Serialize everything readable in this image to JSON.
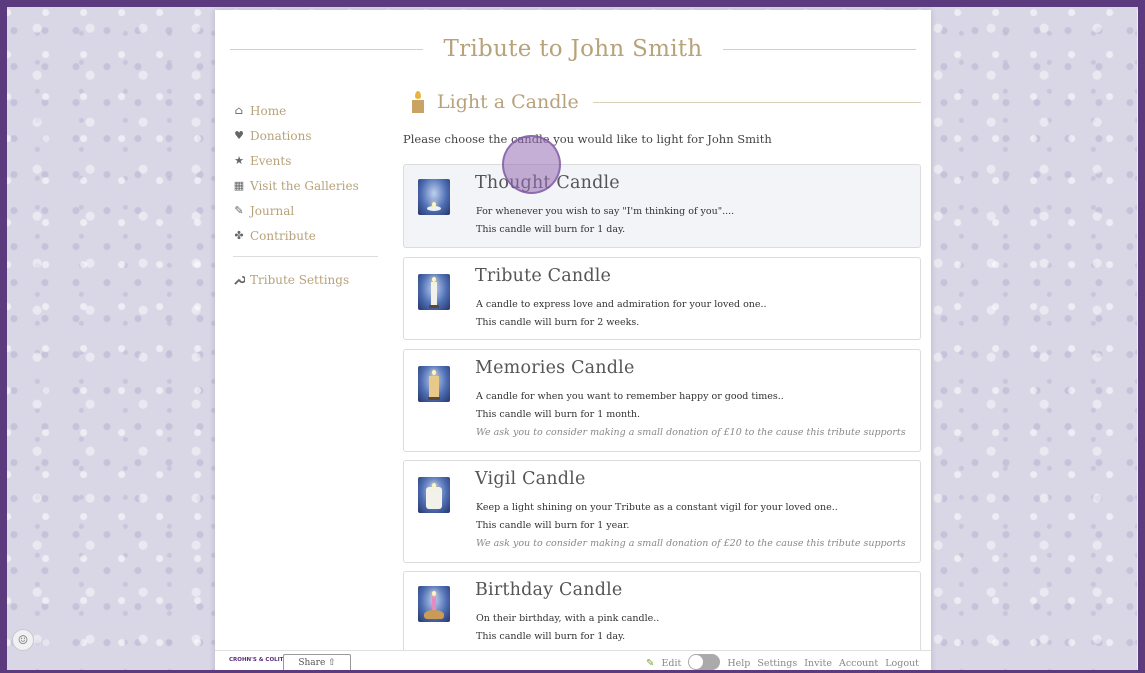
{
  "page_title": "Tribute to John Smith",
  "sidebar": {
    "items": [
      {
        "label": "Home",
        "icon": "home-icon",
        "glyph": "⌂"
      },
      {
        "label": "Donations",
        "icon": "heart-icon",
        "glyph": "♥"
      },
      {
        "label": "Events",
        "icon": "star-icon",
        "glyph": "★"
      },
      {
        "label": "Visit the Galleries",
        "icon": "images-icon",
        "glyph": "▦"
      },
      {
        "label": "Journal",
        "icon": "pen-icon",
        "glyph": "✎"
      },
      {
        "label": "Contribute",
        "icon": "puzzle-icon",
        "glyph": "✤"
      }
    ],
    "settings": {
      "label": "Tribute Settings",
      "icon": "wrench-icon",
      "glyph": "✗"
    }
  },
  "section": {
    "heading": "Light a Candle",
    "intro": "Please choose the candle you would like to light for John Smith"
  },
  "candles": [
    {
      "name": "Thought Candle",
      "desc": "For whenever you wish to say \"I'm thinking of you\"....",
      "burn": "This candle will burn for 1 day.",
      "donation": ""
    },
    {
      "name": "Tribute Candle",
      "desc": "A candle to express love and admiration for your loved one..",
      "burn": "This candle will burn for 2 weeks.",
      "donation": ""
    },
    {
      "name": "Memories Candle",
      "desc": "A candle for when you want to remember happy or good times..",
      "burn": "This candle will burn for 1 month.",
      "donation": "We ask you to consider making a small donation of £10 to the cause this tribute supports"
    },
    {
      "name": "Vigil Candle",
      "desc": "Keep a light shining on your Tribute as a constant vigil for your loved one..",
      "burn": "This candle will burn for 1 year.",
      "donation": "We ask you to consider making a small donation of £20 to the cause this tribute supports"
    },
    {
      "name": "Birthday Candle",
      "desc": "On their birthday, with a pink candle..",
      "burn": "This candle will burn for 1 day.",
      "donation": ""
    }
  ],
  "footer": {
    "logo_text": "CROHN'S & COLITIS UK",
    "share_label": "Share ⇧",
    "edit_label": "Edit",
    "links": [
      "Help",
      "Settings",
      "Invite",
      "Account",
      "Logout"
    ]
  },
  "colors": {
    "frame": "#5b3a7e",
    "accent_gold": "#b8a27a",
    "candle_bg_blue": "#4f6fb4"
  }
}
